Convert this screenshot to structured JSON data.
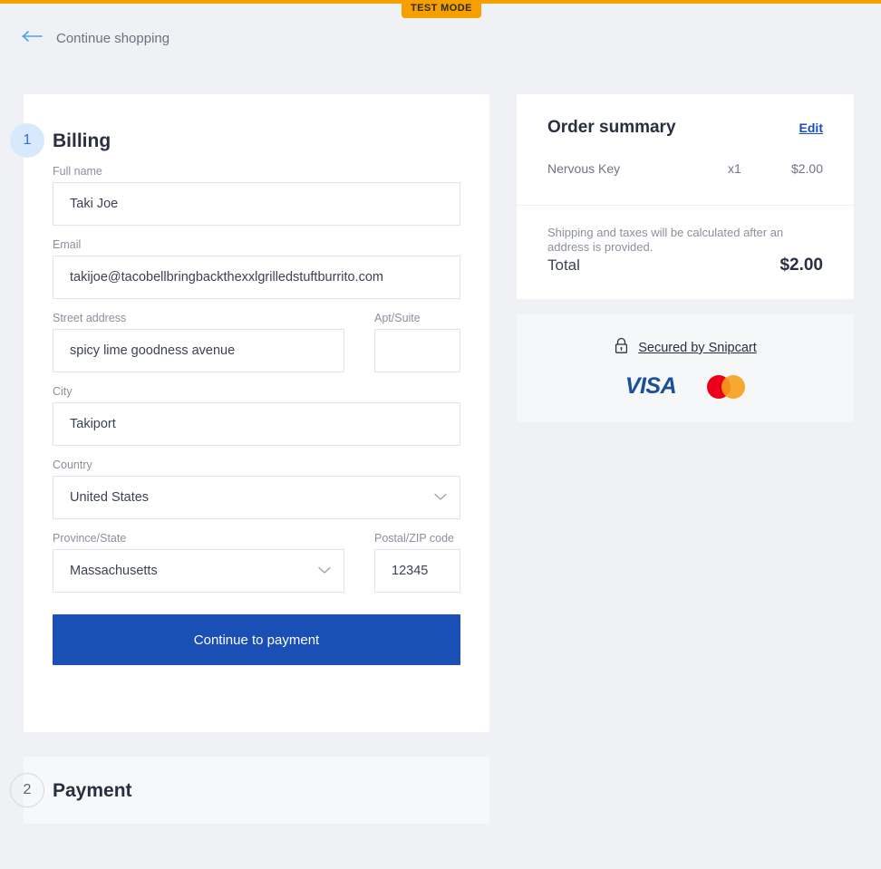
{
  "top": {
    "test_mode_label": "TEST MODE",
    "accent_orange": "#f6a000"
  },
  "nav": {
    "back_label": "Continue shopping",
    "back_icon": "arrow-left-icon"
  },
  "steps": [
    {
      "number": "1",
      "title": "Billing",
      "state": "active"
    },
    {
      "number": "2",
      "title": "Payment",
      "state": "inactive"
    }
  ],
  "billing_form": {
    "full_name": {
      "label": "Full name",
      "value": "Taki Joe"
    },
    "email": {
      "label": "Email",
      "value": "takijoe@tacobellbringbackthexxlgrilledstuftburrito.com"
    },
    "street": {
      "label": "Street address",
      "value": "spicy lime goodness avenue"
    },
    "apt": {
      "label": "Apt/Suite",
      "value": ""
    },
    "city": {
      "label": "City",
      "value": "Takiport"
    },
    "country": {
      "label": "Country",
      "value": "United States"
    },
    "province": {
      "label": "Province/State",
      "value": "Massachusetts"
    },
    "postal": {
      "label": "Postal/ZIP code",
      "value": "12345"
    },
    "submit_label": "Continue to payment",
    "submit_color": "#1a4fb5"
  },
  "order_summary": {
    "title": "Order summary",
    "edit_label": "Edit",
    "items": [
      {
        "name": "Nervous Key",
        "qty": "x1",
        "price": "$2.00"
      }
    ],
    "shipping_note": "Shipping and taxes will be calculated after an address is provided.",
    "total_label": "Total",
    "total_value": "$2.00"
  },
  "secured": {
    "lock_icon": "lock-icon",
    "label": "Secured by Snipcart",
    "cards": [
      {
        "name": "visa-logo",
        "text": "VISA"
      },
      {
        "name": "mastercard-logo",
        "text": ""
      }
    ]
  }
}
